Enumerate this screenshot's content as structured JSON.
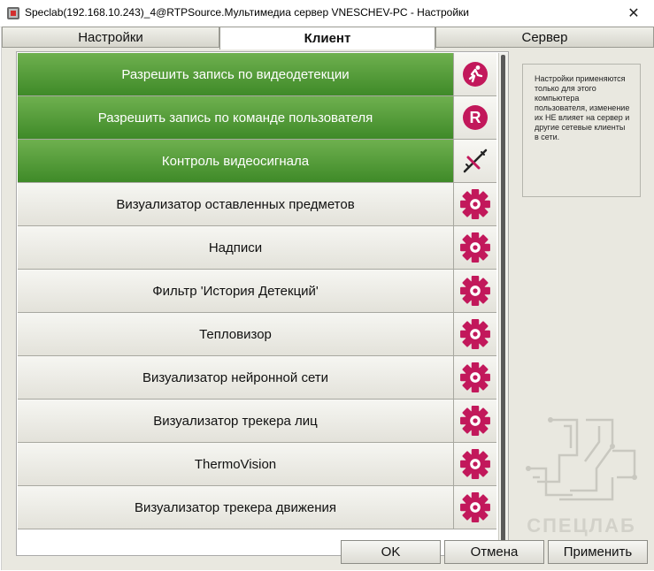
{
  "window": {
    "title": "Speclab(192.168.10.243)_4@RTPSource.Мультимедиа сервер VNESCHEV-PC - Настройки",
    "close_glyph": "✕"
  },
  "tabs": [
    {
      "label": "Настройки",
      "active": false
    },
    {
      "label": "Клиент",
      "active": true
    },
    {
      "label": "Сервер",
      "active": false
    }
  ],
  "items": [
    {
      "label": "Разрешить запись по видеодетекции",
      "enabled": true,
      "icon": "running-man-icon"
    },
    {
      "label": "Разрешить запись по команде пользователя",
      "enabled": true,
      "icon": "record-r-icon"
    },
    {
      "label": "Контроль видеосигнала",
      "enabled": true,
      "icon": "signal-cut-icon"
    },
    {
      "label": "Визуализатор оставленных предметов",
      "enabled": false,
      "icon": "gear-icon"
    },
    {
      "label": "Надписи",
      "enabled": false,
      "icon": "gear-icon"
    },
    {
      "label": "Фильтр 'История Детекций'",
      "enabled": false,
      "icon": "gear-icon"
    },
    {
      "label": "Тепловизор",
      "enabled": false,
      "icon": "gear-icon"
    },
    {
      "label": "Визуализатор нейронной сети",
      "enabled": false,
      "icon": "gear-icon"
    },
    {
      "label": "Визуализатор трекера лиц",
      "enabled": false,
      "icon": "gear-icon"
    },
    {
      "label": "ThermoVision",
      "enabled": false,
      "icon": "gear-icon"
    },
    {
      "label": "Визуализатор трекера движения",
      "enabled": false,
      "icon": "gear-icon"
    }
  ],
  "info_text": "Настройки применяются только для этого компьютера пользователя, изменение их НЕ влияет на сервер и другие сетевые клиенты в сети.",
  "logo_text": "СПЕЦЛАБ",
  "buttons": {
    "ok": "OK",
    "cancel": "Отмена",
    "apply": "Применить"
  },
  "colors": {
    "enabled_row": "#4f9a36",
    "icon_accent": "#c2185b",
    "window_bg": "#e9e8e0"
  }
}
